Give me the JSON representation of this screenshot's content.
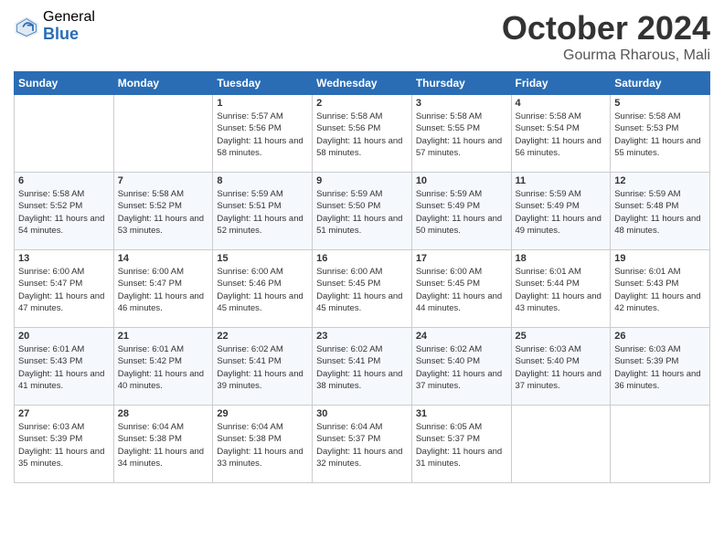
{
  "logo": {
    "general": "General",
    "blue": "Blue"
  },
  "title": "October 2024",
  "location": "Gourma Rharous, Mali",
  "days_of_week": [
    "Sunday",
    "Monday",
    "Tuesday",
    "Wednesday",
    "Thursday",
    "Friday",
    "Saturday"
  ],
  "weeks": [
    [
      {
        "day": "",
        "info": ""
      },
      {
        "day": "",
        "info": ""
      },
      {
        "day": "1",
        "sunrise": "Sunrise: 5:57 AM",
        "sunset": "Sunset: 5:56 PM",
        "daylight": "Daylight: 11 hours and 58 minutes."
      },
      {
        "day": "2",
        "sunrise": "Sunrise: 5:58 AM",
        "sunset": "Sunset: 5:56 PM",
        "daylight": "Daylight: 11 hours and 58 minutes."
      },
      {
        "day": "3",
        "sunrise": "Sunrise: 5:58 AM",
        "sunset": "Sunset: 5:55 PM",
        "daylight": "Daylight: 11 hours and 57 minutes."
      },
      {
        "day": "4",
        "sunrise": "Sunrise: 5:58 AM",
        "sunset": "Sunset: 5:54 PM",
        "daylight": "Daylight: 11 hours and 56 minutes."
      },
      {
        "day": "5",
        "sunrise": "Sunrise: 5:58 AM",
        "sunset": "Sunset: 5:53 PM",
        "daylight": "Daylight: 11 hours and 55 minutes."
      }
    ],
    [
      {
        "day": "6",
        "sunrise": "Sunrise: 5:58 AM",
        "sunset": "Sunset: 5:52 PM",
        "daylight": "Daylight: 11 hours and 54 minutes."
      },
      {
        "day": "7",
        "sunrise": "Sunrise: 5:58 AM",
        "sunset": "Sunset: 5:52 PM",
        "daylight": "Daylight: 11 hours and 53 minutes."
      },
      {
        "day": "8",
        "sunrise": "Sunrise: 5:59 AM",
        "sunset": "Sunset: 5:51 PM",
        "daylight": "Daylight: 11 hours and 52 minutes."
      },
      {
        "day": "9",
        "sunrise": "Sunrise: 5:59 AM",
        "sunset": "Sunset: 5:50 PM",
        "daylight": "Daylight: 11 hours and 51 minutes."
      },
      {
        "day": "10",
        "sunrise": "Sunrise: 5:59 AM",
        "sunset": "Sunset: 5:49 PM",
        "daylight": "Daylight: 11 hours and 50 minutes."
      },
      {
        "day": "11",
        "sunrise": "Sunrise: 5:59 AM",
        "sunset": "Sunset: 5:49 PM",
        "daylight": "Daylight: 11 hours and 49 minutes."
      },
      {
        "day": "12",
        "sunrise": "Sunrise: 5:59 AM",
        "sunset": "Sunset: 5:48 PM",
        "daylight": "Daylight: 11 hours and 48 minutes."
      }
    ],
    [
      {
        "day": "13",
        "sunrise": "Sunrise: 6:00 AM",
        "sunset": "Sunset: 5:47 PM",
        "daylight": "Daylight: 11 hours and 47 minutes."
      },
      {
        "day": "14",
        "sunrise": "Sunrise: 6:00 AM",
        "sunset": "Sunset: 5:47 PM",
        "daylight": "Daylight: 11 hours and 46 minutes."
      },
      {
        "day": "15",
        "sunrise": "Sunrise: 6:00 AM",
        "sunset": "Sunset: 5:46 PM",
        "daylight": "Daylight: 11 hours and 45 minutes."
      },
      {
        "day": "16",
        "sunrise": "Sunrise: 6:00 AM",
        "sunset": "Sunset: 5:45 PM",
        "daylight": "Daylight: 11 hours and 45 minutes."
      },
      {
        "day": "17",
        "sunrise": "Sunrise: 6:00 AM",
        "sunset": "Sunset: 5:45 PM",
        "daylight": "Daylight: 11 hours and 44 minutes."
      },
      {
        "day": "18",
        "sunrise": "Sunrise: 6:01 AM",
        "sunset": "Sunset: 5:44 PM",
        "daylight": "Daylight: 11 hours and 43 minutes."
      },
      {
        "day": "19",
        "sunrise": "Sunrise: 6:01 AM",
        "sunset": "Sunset: 5:43 PM",
        "daylight": "Daylight: 11 hours and 42 minutes."
      }
    ],
    [
      {
        "day": "20",
        "sunrise": "Sunrise: 6:01 AM",
        "sunset": "Sunset: 5:43 PM",
        "daylight": "Daylight: 11 hours and 41 minutes."
      },
      {
        "day": "21",
        "sunrise": "Sunrise: 6:01 AM",
        "sunset": "Sunset: 5:42 PM",
        "daylight": "Daylight: 11 hours and 40 minutes."
      },
      {
        "day": "22",
        "sunrise": "Sunrise: 6:02 AM",
        "sunset": "Sunset: 5:41 PM",
        "daylight": "Daylight: 11 hours and 39 minutes."
      },
      {
        "day": "23",
        "sunrise": "Sunrise: 6:02 AM",
        "sunset": "Sunset: 5:41 PM",
        "daylight": "Daylight: 11 hours and 38 minutes."
      },
      {
        "day": "24",
        "sunrise": "Sunrise: 6:02 AM",
        "sunset": "Sunset: 5:40 PM",
        "daylight": "Daylight: 11 hours and 37 minutes."
      },
      {
        "day": "25",
        "sunrise": "Sunrise: 6:03 AM",
        "sunset": "Sunset: 5:40 PM",
        "daylight": "Daylight: 11 hours and 37 minutes."
      },
      {
        "day": "26",
        "sunrise": "Sunrise: 6:03 AM",
        "sunset": "Sunset: 5:39 PM",
        "daylight": "Daylight: 11 hours and 36 minutes."
      }
    ],
    [
      {
        "day": "27",
        "sunrise": "Sunrise: 6:03 AM",
        "sunset": "Sunset: 5:39 PM",
        "daylight": "Daylight: 11 hours and 35 minutes."
      },
      {
        "day": "28",
        "sunrise": "Sunrise: 6:04 AM",
        "sunset": "Sunset: 5:38 PM",
        "daylight": "Daylight: 11 hours and 34 minutes."
      },
      {
        "day": "29",
        "sunrise": "Sunrise: 6:04 AM",
        "sunset": "Sunset: 5:38 PM",
        "daylight": "Daylight: 11 hours and 33 minutes."
      },
      {
        "day": "30",
        "sunrise": "Sunrise: 6:04 AM",
        "sunset": "Sunset: 5:37 PM",
        "daylight": "Daylight: 11 hours and 32 minutes."
      },
      {
        "day": "31",
        "sunrise": "Sunrise: 6:05 AM",
        "sunset": "Sunset: 5:37 PM",
        "daylight": "Daylight: 11 hours and 31 minutes."
      },
      {
        "day": "",
        "info": ""
      },
      {
        "day": "",
        "info": ""
      }
    ]
  ]
}
